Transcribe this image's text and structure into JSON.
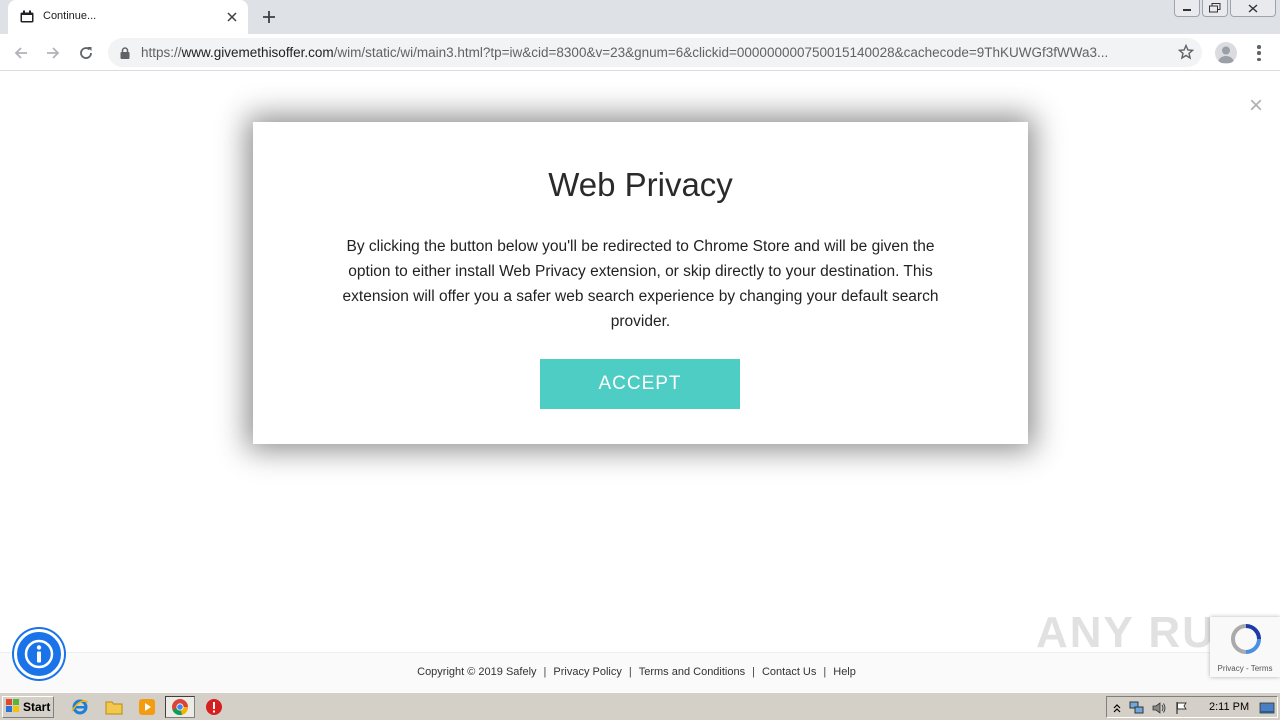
{
  "browser": {
    "tab_title": "Continue...",
    "url_scheme": "https://",
    "url_host": "www.givemethisoffer.com",
    "url_path": "/wim/static/wi/main3.html?tp=iw&cid=8300&v=23&gnum=6&clickid=000000000750015140028&cachecode=9ThKUWGf3fWWa3..."
  },
  "modal": {
    "title": "Web Privacy",
    "body": "By clicking the button below you'll be redirected to Chrome Store and will be given the option to either install Web Privacy extension, or skip directly to your destination. This extension will offer you a safer web search experience by changing your default search provider.",
    "accept_label": "ACCEPT"
  },
  "page_close_glyph": "×",
  "footer": {
    "copyright": "Copyright © 2019 Safely",
    "links": [
      "Privacy Policy",
      "Terms and Conditions",
      "Contact Us",
      "Help"
    ]
  },
  "recaptcha": {
    "links": "Privacy - Terms"
  },
  "watermark": "ANY RUN",
  "taskbar": {
    "start_label": "Start",
    "clock": "2:11 PM"
  },
  "colors": {
    "accent": "#4ecdc4",
    "info_blue": "#1a73e8",
    "chrome_tabstrip": "#dee1e6",
    "taskbar": "#d4d0c8"
  }
}
